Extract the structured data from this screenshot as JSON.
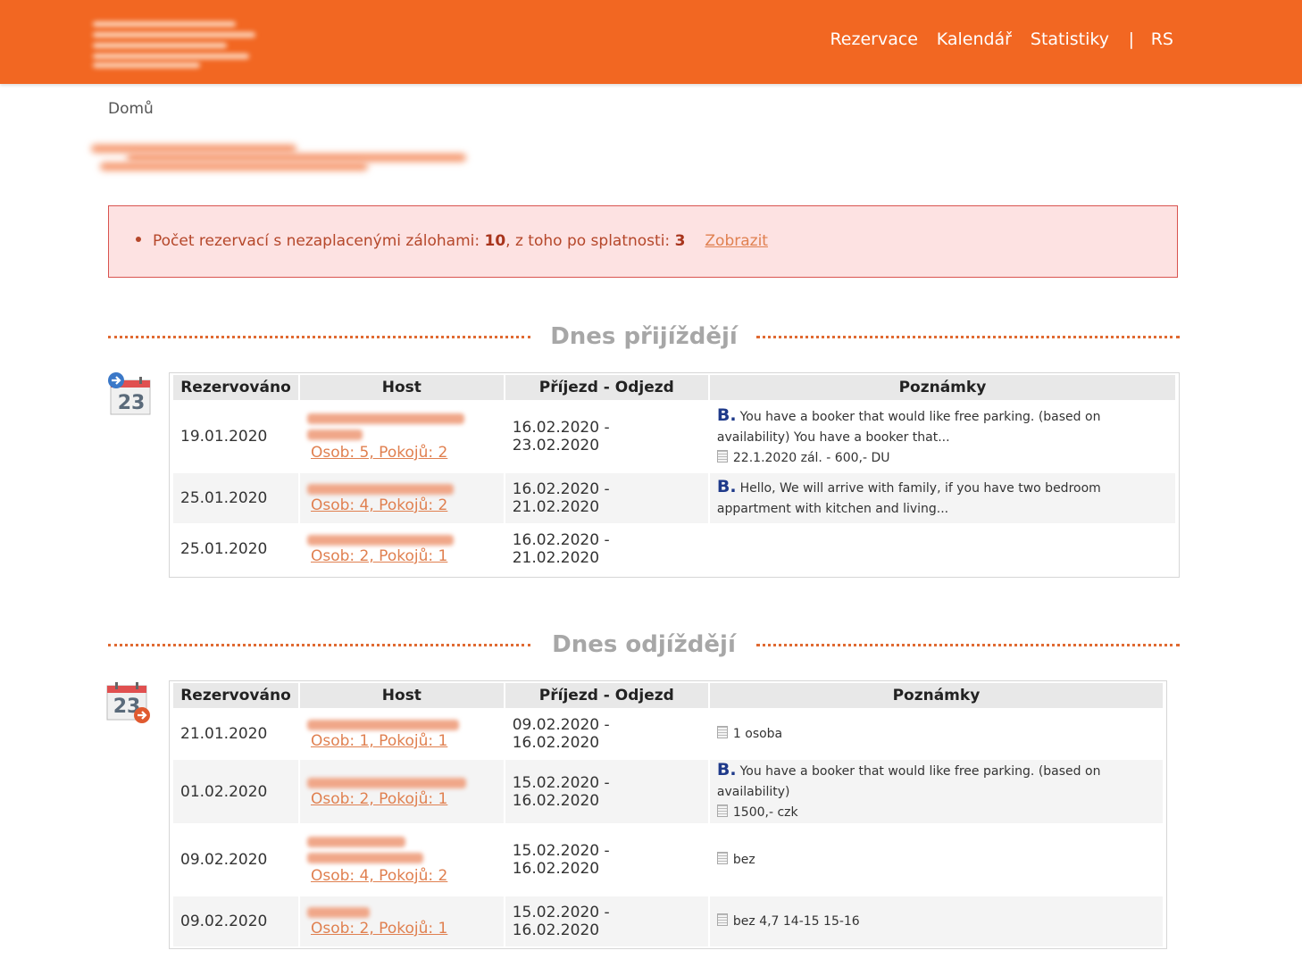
{
  "nav": {
    "items": [
      {
        "label": "Rezervace"
      },
      {
        "label": "Kalendář"
      },
      {
        "label": "Statistiky"
      }
    ],
    "separator": "|",
    "user": "RS"
  },
  "breadcrumb": "Domů",
  "alert": {
    "prefix": "Počet rezervací s nezaplacenými zálohami: ",
    "count": "10",
    "middle": ", z toho po splatnosti: ",
    "overdue": "3",
    "link": "Zobrazit"
  },
  "arrivals": {
    "title": "Dnes přijíždějí",
    "icon_day": "23",
    "columns": [
      "Rezervováno",
      "Host",
      "Příjezd - Odjezd",
      "Poznámky"
    ],
    "rows": [
      {
        "booked": "19.01.2020",
        "guest_link": "Osob: 5, Pokojů: 2",
        "dates": "16.02.2020 - 23.02.2020",
        "booking_note": "You have a booker that would like free parking. (based on availability) You have a booker that...",
        "note": "22.1.2020 zál. - 600,- DU"
      },
      {
        "booked": "25.01.2020",
        "guest_link": "Osob: 4, Pokojů: 2",
        "dates": "16.02.2020 - 21.02.2020",
        "booking_note": "Hello, We will arrive with family, if you have two bedroom appartment with kitchen and living...",
        "note": ""
      },
      {
        "booked": "25.01.2020",
        "guest_link": "Osob: 2, Pokojů: 1",
        "dates": "16.02.2020 - 21.02.2020",
        "booking_note": "",
        "note": ""
      }
    ]
  },
  "departures": {
    "title": "Dnes odjíždějí",
    "icon_day": "23",
    "columns": [
      "Rezervováno",
      "Host",
      "Příjezd - Odjezd",
      "Poznámky"
    ],
    "rows": [
      {
        "booked": "21.01.2020",
        "guest_link": "Osob: 1, Pokojů: 1",
        "dates": "09.02.2020 - 16.02.2020",
        "booking_note": "",
        "note": "1 osoba"
      },
      {
        "booked": "01.02.2020",
        "guest_link": "Osob: 2, Pokojů: 1",
        "dates": "15.02.2020 - 16.02.2020",
        "booking_note": "You have a booker that would like free parking. (based on availability)",
        "note": "1500,- czk"
      },
      {
        "booked": "09.02.2020",
        "guest_link": "Osob: 4, Pokojů: 2",
        "dates": "15.02.2020 - 16.02.2020",
        "booking_note": "",
        "note": "bez"
      },
      {
        "booked": "09.02.2020",
        "guest_link": "Osob: 2, Pokojů: 1",
        "dates": "15.02.2020 - 16.02.2020",
        "booking_note": "",
        "note": "bez 4,7 14-15 15-16"
      }
    ]
  },
  "booking_badge": "B.",
  "colors": {
    "brand": "#f26722",
    "link": "#e08050",
    "alert_bg": "#fde2e2",
    "booking": "#1f3a8a"
  }
}
